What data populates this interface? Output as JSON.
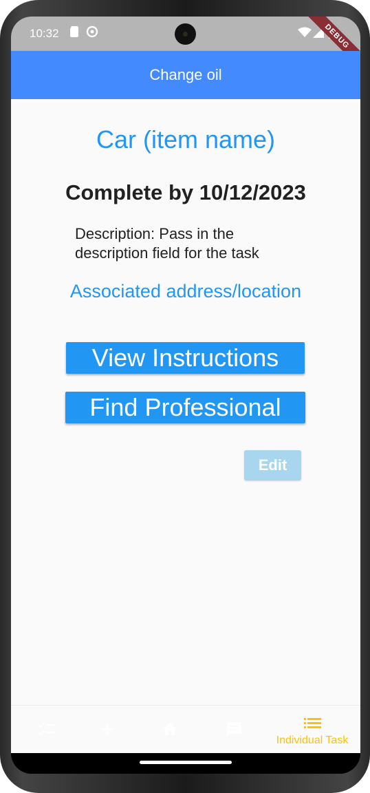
{
  "status_bar": {
    "time": "10:32",
    "icons": [
      "sd-card-icon",
      "assistant-icon",
      "wifi-icon",
      "signal-icon",
      "battery-icon"
    ],
    "debug_banner": "DEBUG"
  },
  "app_bar": {
    "title": "Change oil",
    "color": "#448aff"
  },
  "task": {
    "item_name": "Car (item name)",
    "due": "Complete by 10/12/2023",
    "description": "Description: Pass in the description field for the task",
    "address": "Associated address/location"
  },
  "actions": {
    "view_instructions": "View Instructions",
    "find_professional": "Find Professional",
    "edit": "Edit"
  },
  "bottom_nav": {
    "items": [
      {
        "icon": "checklist-icon",
        "label": ""
      },
      {
        "icon": "add-icon",
        "label": ""
      },
      {
        "icon": "home-icon",
        "label": ""
      },
      {
        "icon": "chat-icon",
        "label": ""
      },
      {
        "icon": "list-icon",
        "label": "Individual Task"
      }
    ],
    "active_index": 4,
    "active_color": "#ffc107"
  },
  "colors": {
    "primary": "#2196f3",
    "edit_disabled": "#a7d6ee"
  }
}
